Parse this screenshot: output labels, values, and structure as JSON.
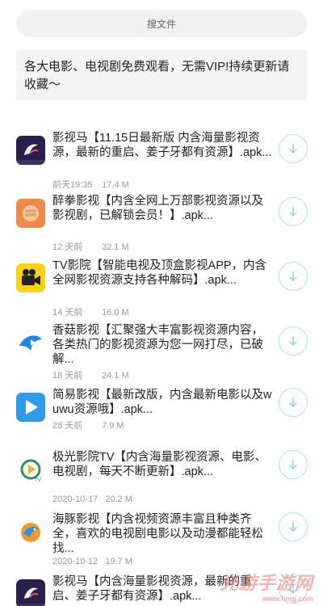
{
  "search": {
    "placeholder": "搜文件"
  },
  "notice": "各大电影、电视剧免费观看，无需VIP!持续更新请收藏～",
  "items": [
    {
      "title": "影视马【11.15日最新版 内含海量影视资源，最新的重启、姜子牙都有资源】.apk...",
      "date": "前天19:35",
      "size": "17.4 M",
      "icon": "yingshima-app-icon"
    },
    {
      "title": "醉拳影视【内含全网上万部影视资源以及影视剧，已解锁会员！】.apk...",
      "date": "12 天前",
      "size": "32.1 M",
      "icon": "zuiquan-app-icon"
    },
    {
      "title": "TV影院【智能电视及顶盒影视APP，内含全网影视资源支持各种解码】.apk...",
      "date": "14 天前",
      "size": "16.0 M",
      "icon": "tv-yingyuan-app-icon"
    },
    {
      "title": "香菇影视【汇聚强大丰富影视资源内容，各类热门的影视资源为您一网打尽，已破解...",
      "date": "18 天前",
      "size": "24.1 M",
      "icon": "xianggu-app-icon"
    },
    {
      "title": "简易影视【最新改版，内含最新电影以及wuwu资源哦】.apk...",
      "date": "28 天前",
      "size": "7.9 M",
      "icon": "jianyi-app-icon"
    },
    {
      "title": "极光影院TV【内含海量影视资源、电影、电视剧，每天不断更新】.apk...",
      "date": "2020-10-17",
      "size": "20.2 M",
      "icon": "jiguang-app-icon"
    },
    {
      "title": "海豚影视【内含视频资源丰富且种类齐全，喜欢的电视剧电影以及动漫都能轻松找...",
      "date": "2020-10-12",
      "size": "19.7 M",
      "icon": "haitun-app-icon"
    },
    {
      "title": "影视马【内含海量影视资源，最新的重启、姜子牙都有资源】.apk...",
      "date": "",
      "size": "",
      "icon": "yingshima-app-icon"
    }
  ],
  "watermark": {
    "main": "光游手游网",
    "sub": "www.hnqj.com"
  },
  "colors": {
    "accent": "#aee2ef",
    "arrow": "#8fd3e6"
  }
}
